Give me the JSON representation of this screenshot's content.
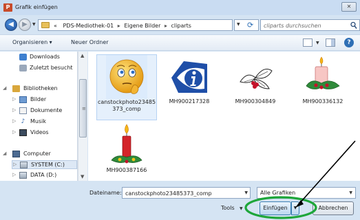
{
  "window": {
    "title": "Grafik einfügen",
    "app_icon_letter": "P",
    "close_glyph": "✕"
  },
  "address": {
    "overflow_glyph": "«",
    "crumbs": [
      "PDS-Mediothek-01",
      "Eigene Bilder",
      "cliparts"
    ],
    "separator": "▸",
    "search_placeholder": "cliparts durchsuchen"
  },
  "toolbar": {
    "organize_label": "Organisieren ▾",
    "new_folder_label": "Neuer Ordner",
    "help_glyph": "?"
  },
  "nav": {
    "items": [
      {
        "label": "Downloads",
        "icon": "downloads-icon"
      },
      {
        "label": "Zuletzt besucht",
        "icon": "recent-icon"
      },
      {
        "label": "Bibliotheken",
        "icon": "libraries-icon"
      },
      {
        "label": "Bilder",
        "icon": "pictures-icon"
      },
      {
        "label": "Dokumente",
        "icon": "documents-icon"
      },
      {
        "label": "Musik",
        "icon": "music-icon"
      },
      {
        "label": "Videos",
        "icon": "videos-icon"
      },
      {
        "label": "Computer",
        "icon": "computer-icon"
      },
      {
        "label": "SYSTEM (C:)",
        "icon": "drive-icon"
      },
      {
        "label": "DATA (D:)",
        "icon": "drive-icon"
      }
    ]
  },
  "files": [
    {
      "label": "canstockphoto23485373_comp",
      "icon": "thinking-emoji-icon",
      "selected": true
    },
    {
      "label": "MH900217328",
      "icon": "info-logo-icon"
    },
    {
      "label": "MH900304849",
      "icon": "holly-icon"
    },
    {
      "label": "MH900336132",
      "icon": "candle-wreath-icon"
    },
    {
      "label": "MH900387166",
      "icon": "candle-icon"
    }
  ],
  "bottom": {
    "filename_label": "Dateiname:",
    "filename_value": "canstockphoto23485373_comp",
    "filter_value": "Alle Grafiken",
    "tools_label": "Tools",
    "insert_label": "Einfügen",
    "cancel_label": "Abbrechen"
  },
  "annotation": {
    "highlight_color": "#1ea63a",
    "arrow_color": "#000000"
  }
}
